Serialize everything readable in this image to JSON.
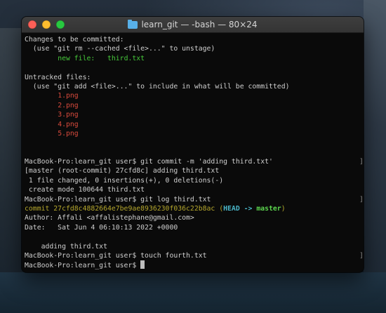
{
  "window": {
    "title": "learn_git — -bash — 80×24"
  },
  "terminal": {
    "staged": {
      "header": "Changes to be committed:",
      "hint": "  (use \"git rm --cached <file>...\" to unstage)",
      "label": "new file:",
      "file": "third.txt"
    },
    "untracked": {
      "header": "Untracked files:",
      "hint": "  (use \"git add <file>...\" to include in what will be committed)",
      "files": [
        "1.png",
        "2.png",
        "3.png",
        "4.png",
        "5.png"
      ]
    },
    "commit_cmd": {
      "prompt": "MacBook-Pro:learn_git user$ ",
      "command": "git commit -m 'adding third.txt'"
    },
    "commit_output": [
      "[master (root-commit) 27cfd8c] adding third.txt",
      " 1 file changed, 0 insertions(+), 0 deletions(-)",
      " create mode 100644 third.txt"
    ],
    "log_cmd": {
      "prompt": "MacBook-Pro:learn_git user$ ",
      "command": "git log third.txt"
    },
    "log": {
      "commit_label": "commit 27cfd8c4882664e7be9ae8936230f036c22b8ac",
      "paren_open": " (",
      "head": "HEAD -> ",
      "branch": "master",
      "paren_close": ")",
      "author": "Author: Affali <affalistephane@gmail.com>",
      "date": "Date:   Sat Jun 4 06:10:13 2022 +0000",
      "message": "    adding third.txt"
    },
    "touch_cmd": {
      "prompt": "MacBook-Pro:learn_git user$ ",
      "command": "touch fourth.txt"
    },
    "current_prompt": "MacBook-Pro:learn_git user$ ",
    "bracket": "]"
  }
}
